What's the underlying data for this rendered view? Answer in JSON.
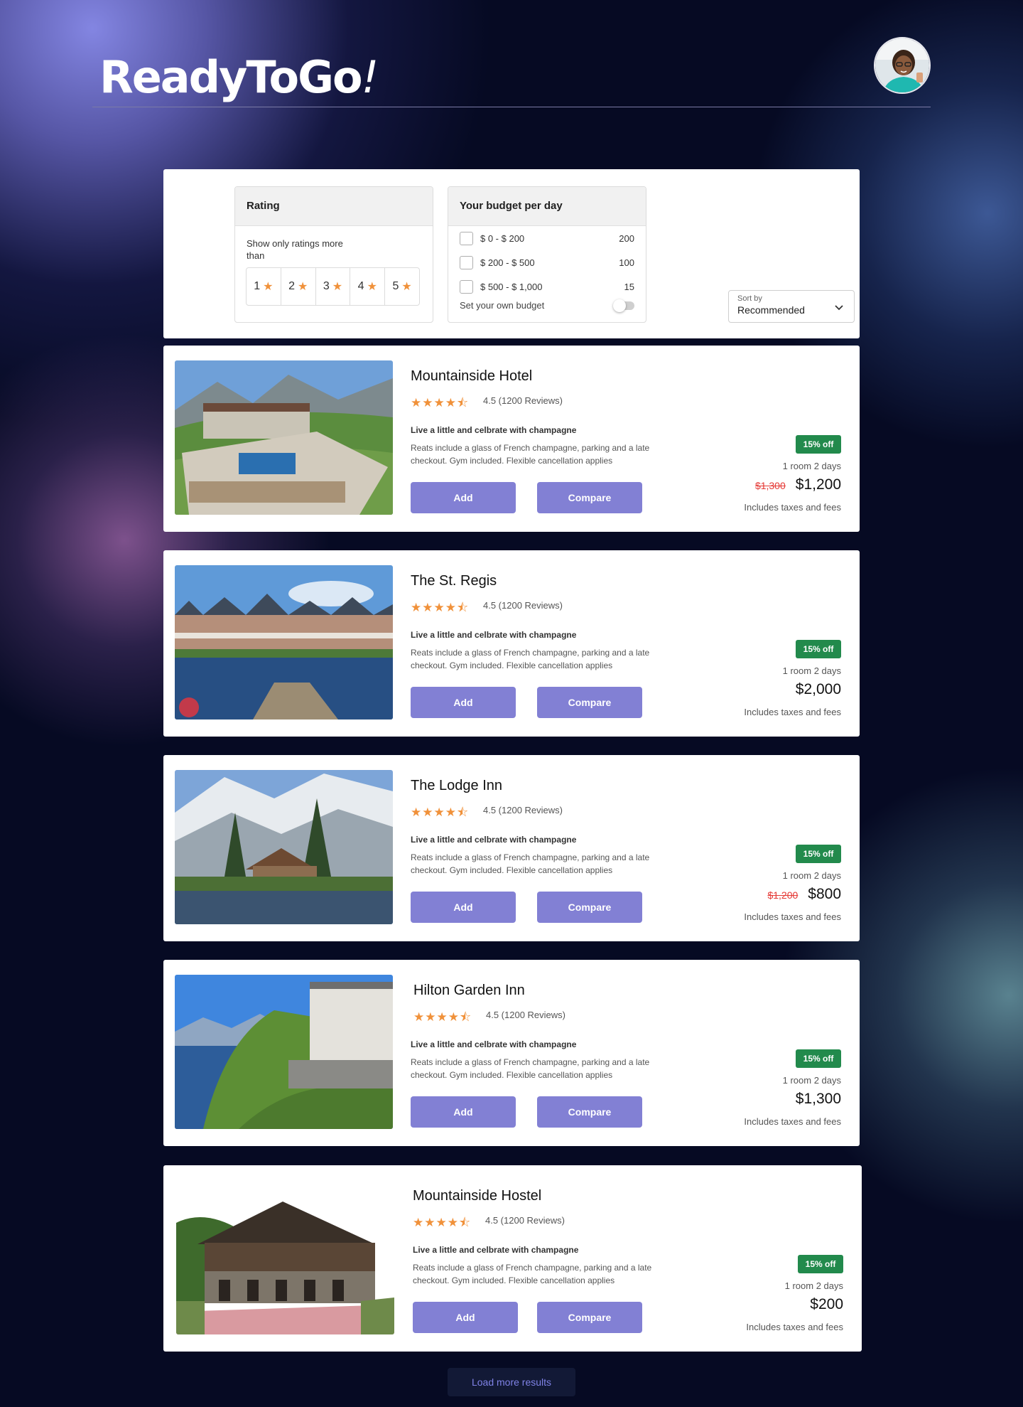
{
  "header": {
    "logo_text": "ReadyToGo",
    "logo_mark": "!",
    "avatar": "user-avatar"
  },
  "filters": {
    "rating": {
      "title": "Rating",
      "note": "Show only ratings more than",
      "options": [
        "1",
        "2",
        "3",
        "4",
        "5"
      ]
    },
    "budget": {
      "title": "Your budget per day",
      "ranges": [
        {
          "label": "$ 0 - $ 200",
          "count": "200"
        },
        {
          "label": "$ 200 - $ 500",
          "count": "100"
        },
        {
          "label": "$ 500 - $ 1,000",
          "count": "15"
        }
      ],
      "own_budget_label": "Set your own budget"
    },
    "sort": {
      "label": "Sort by",
      "value": "Recommended"
    }
  },
  "hotels": [
    {
      "name": "Mountainside Hotel",
      "rating_stars": 4.5,
      "reviews": "4.5 (1200 Reviews)",
      "tagline": "Live a little and celbrate with champagne",
      "description": "Reats include a glass of French champagne, parking and a late checkout. Gym included. Flexible cancellation applies",
      "add_label": "Add",
      "compare_label": "Compare",
      "discount": "15% off",
      "room": "1 room 2 days",
      "old_price": "$1,300",
      "price": "$1,200",
      "taxes": "Includes taxes and fees"
    },
    {
      "name": "The St. Regis",
      "rating_stars": 4.5,
      "reviews": "4.5 (1200 Reviews)",
      "tagline": "Live a little and celbrate with champagne",
      "description": "Reats include a glass of French champagne, parking and a late checkout. Gym included. Flexible cancellation applies",
      "add_label": "Add",
      "compare_label": "Compare",
      "discount": "15% off",
      "room": "1 room 2 days",
      "old_price": "",
      "price": "$2,000",
      "taxes": "Includes taxes and fees"
    },
    {
      "name": "The Lodge Inn",
      "rating_stars": 4.5,
      "reviews": "4.5 (1200 Reviews)",
      "tagline": "Live a little and celbrate with champagne",
      "description": "Reats include a glass of French champagne, parking and a late checkout. Gym included. Flexible cancellation applies",
      "add_label": "Add",
      "compare_label": "Compare",
      "discount": "15% off",
      "room": "1 room 2 days",
      "old_price": "$1,200",
      "price": "$800",
      "taxes": "Includes taxes and fees"
    },
    {
      "name": "Hilton Garden Inn",
      "rating_stars": 4.5,
      "reviews": "4.5 (1200 Reviews)",
      "tagline": "Live a little and celbrate with champagne",
      "description": "Reats include a glass of French champagne, parking and a late checkout. Gym included. Flexible cancellation applies",
      "add_label": "Add",
      "compare_label": "Compare",
      "discount": "15% off",
      "room": "1 room 2 days",
      "old_price": "",
      "price": "$1,300",
      "taxes": "Includes taxes and fees"
    },
    {
      "name": "Mountainside Hostel",
      "rating_stars": 4.5,
      "reviews": "4.5 (1200 Reviews)",
      "tagline": "Live a little and celbrate with champagne",
      "description": "Reats include a glass of French champagne, parking and a late checkout. Gym included. Flexible cancellation applies",
      "add_label": "Add",
      "compare_label": "Compare",
      "discount": "15% off",
      "room": "1 room 2 days",
      "old_price": "",
      "price": "$200",
      "taxes": "Includes taxes and fees"
    }
  ],
  "load_more_label": "Load more results",
  "colors": {
    "accent": "#8280d4",
    "discount_badge": "#228a4c",
    "star": "#f0913a",
    "old_price": "#e53935",
    "background": "#060a23"
  }
}
